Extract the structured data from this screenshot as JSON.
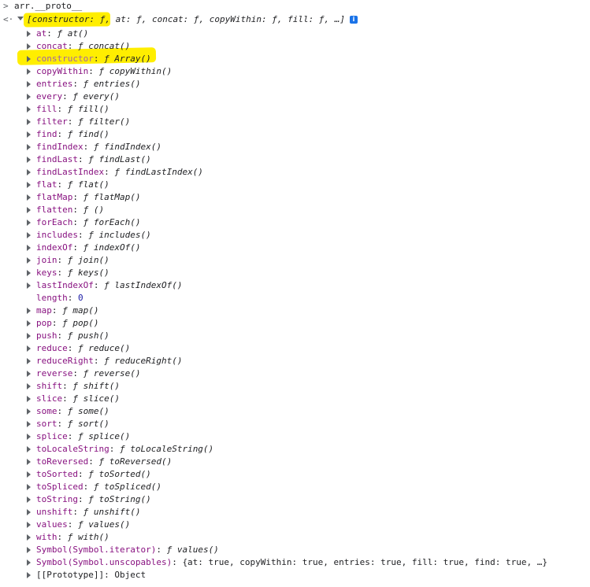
{
  "console": {
    "command": "arr.__proto__",
    "prompt_symbol": ">",
    "result_symbol": "<·",
    "summary": {
      "open": "[",
      "entries": [
        "constructor: ƒ",
        "at: ƒ",
        "concat: ƒ",
        "copyWithin: ƒ",
        "fill: ƒ",
        "…"
      ],
      "text_a": "constructor: ƒ,",
      "text_b": " at: ƒ, concat: ƒ, copyWithin: ƒ, fill: ƒ, …]",
      "info_icon": "i"
    },
    "properties": [
      {
        "key": "at",
        "value": "at()",
        "expandable": true,
        "kind": "fn"
      },
      {
        "key": "concat",
        "value": "concat()",
        "expandable": true,
        "kind": "fn"
      },
      {
        "key": "constructor",
        "value": "Array()",
        "expandable": true,
        "kind": "fn",
        "dim": true
      },
      {
        "key": "copyWithin",
        "value": "copyWithin()",
        "expandable": true,
        "kind": "fn"
      },
      {
        "key": "entries",
        "value": "entries()",
        "expandable": true,
        "kind": "fn"
      },
      {
        "key": "every",
        "value": "every()",
        "expandable": true,
        "kind": "fn"
      },
      {
        "key": "fill",
        "value": "fill()",
        "expandable": true,
        "kind": "fn"
      },
      {
        "key": "filter",
        "value": "filter()",
        "expandable": true,
        "kind": "fn"
      },
      {
        "key": "find",
        "value": "find()",
        "expandable": true,
        "kind": "fn"
      },
      {
        "key": "findIndex",
        "value": "findIndex()",
        "expandable": true,
        "kind": "fn"
      },
      {
        "key": "findLast",
        "value": "findLast()",
        "expandable": true,
        "kind": "fn"
      },
      {
        "key": "findLastIndex",
        "value": "findLastIndex()",
        "expandable": true,
        "kind": "fn"
      },
      {
        "key": "flat",
        "value": "flat()",
        "expandable": true,
        "kind": "fn"
      },
      {
        "key": "flatMap",
        "value": "flatMap()",
        "expandable": true,
        "kind": "fn"
      },
      {
        "key": "flatten",
        "value": "()",
        "expandable": true,
        "kind": "fn"
      },
      {
        "key": "forEach",
        "value": "forEach()",
        "expandable": true,
        "kind": "fn"
      },
      {
        "key": "includes",
        "value": "includes()",
        "expandable": true,
        "kind": "fn"
      },
      {
        "key": "indexOf",
        "value": "indexOf()",
        "expandable": true,
        "kind": "fn"
      },
      {
        "key": "join",
        "value": "join()",
        "expandable": true,
        "kind": "fn"
      },
      {
        "key": "keys",
        "value": "keys()",
        "expandable": true,
        "kind": "fn"
      },
      {
        "key": "lastIndexOf",
        "value": "lastIndexOf()",
        "expandable": true,
        "kind": "fn"
      },
      {
        "key": "length",
        "value": "0",
        "expandable": false,
        "kind": "num"
      },
      {
        "key": "map",
        "value": "map()",
        "expandable": true,
        "kind": "fn"
      },
      {
        "key": "pop",
        "value": "pop()",
        "expandable": true,
        "kind": "fn"
      },
      {
        "key": "push",
        "value": "push()",
        "expandable": true,
        "kind": "fn"
      },
      {
        "key": "reduce",
        "value": "reduce()",
        "expandable": true,
        "kind": "fn"
      },
      {
        "key": "reduceRight",
        "value": "reduceRight()",
        "expandable": true,
        "kind": "fn"
      },
      {
        "key": "reverse",
        "value": "reverse()",
        "expandable": true,
        "kind": "fn"
      },
      {
        "key": "shift",
        "value": "shift()",
        "expandable": true,
        "kind": "fn"
      },
      {
        "key": "slice",
        "value": "slice()",
        "expandable": true,
        "kind": "fn"
      },
      {
        "key": "some",
        "value": "some()",
        "expandable": true,
        "kind": "fn"
      },
      {
        "key": "sort",
        "value": "sort()",
        "expandable": true,
        "kind": "fn"
      },
      {
        "key": "splice",
        "value": "splice()",
        "expandable": true,
        "kind": "fn"
      },
      {
        "key": "toLocaleString",
        "value": "toLocaleString()",
        "expandable": true,
        "kind": "fn"
      },
      {
        "key": "toReversed",
        "value": "toReversed()",
        "expandable": true,
        "kind": "fn"
      },
      {
        "key": "toSorted",
        "value": "toSorted()",
        "expandable": true,
        "kind": "fn"
      },
      {
        "key": "toSpliced",
        "value": "toSpliced()",
        "expandable": true,
        "kind": "fn"
      },
      {
        "key": "toString",
        "value": "toString()",
        "expandable": true,
        "kind": "fn"
      },
      {
        "key": "unshift",
        "value": "unshift()",
        "expandable": true,
        "kind": "fn"
      },
      {
        "key": "values",
        "value": "values()",
        "expandable": true,
        "kind": "fn"
      },
      {
        "key": "with",
        "value": "with()",
        "expandable": true,
        "kind": "fn"
      },
      {
        "key": "Symbol(Symbol.iterator)",
        "value": "values()",
        "expandable": true,
        "kind": "fn"
      },
      {
        "key": "Symbol(Symbol.unscopables)",
        "value": "{at: true, copyWithin: true, entries: true, fill: true, find: true, …}",
        "expandable": true,
        "kind": "obj"
      },
      {
        "key": "[[Prototype]]",
        "value": "Object",
        "expandable": true,
        "kind": "proto"
      }
    ],
    "function_symbol": "ƒ",
    "colors": {
      "key": "#881280",
      "key_dim": "#a064a8",
      "number": "#1a1aa6",
      "highlight": "#ffee00",
      "info_badge": "#1a73e8"
    }
  }
}
